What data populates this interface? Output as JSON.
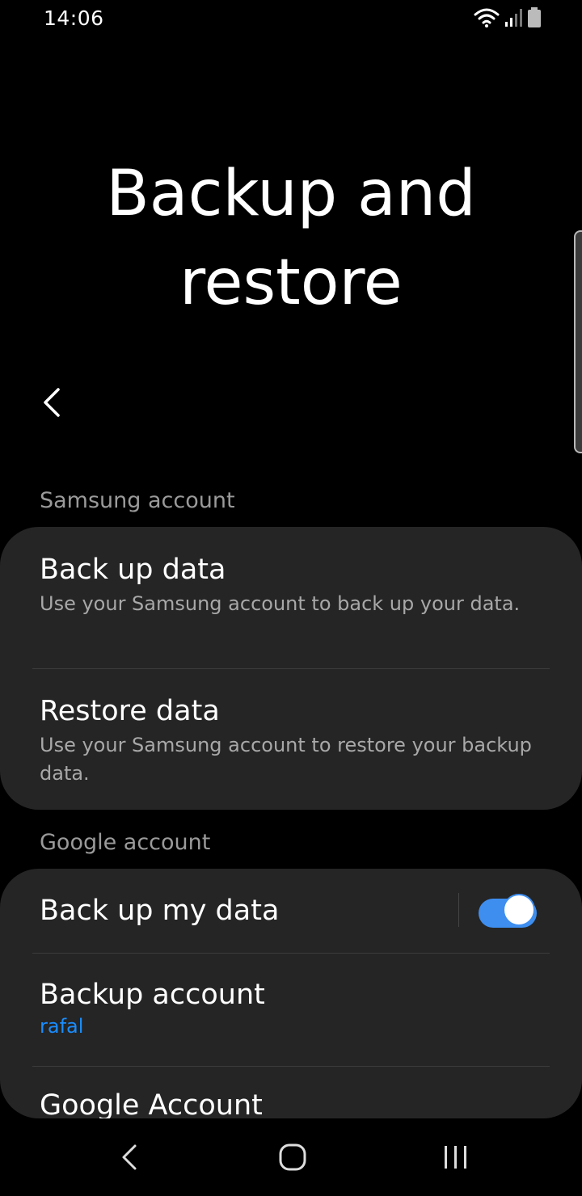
{
  "status_bar": {
    "time": "14:06",
    "icons": [
      "wifi-icon",
      "signal-icon",
      "battery-icon"
    ]
  },
  "page": {
    "title": "Backup and restore"
  },
  "sections": {
    "samsung": {
      "header": "Samsung account",
      "items": [
        {
          "title": "Back up data",
          "subtitle": "Use your Samsung account to back up your data."
        },
        {
          "title": "Restore data",
          "subtitle": "Use your Samsung account to restore your backup data."
        }
      ]
    },
    "google": {
      "header": "Google account",
      "items": [
        {
          "title": "Back up my data",
          "toggle_on": true
        },
        {
          "title": "Backup account",
          "value": "rafal"
        },
        {
          "title": "Google Account"
        }
      ]
    }
  },
  "colors": {
    "background": "#000000",
    "card": "#252525",
    "accent": "#3e8ef0",
    "link": "#1a8dff",
    "secondary_text": "#a8a8a8"
  },
  "nav_bar": {
    "icons": [
      "back-icon",
      "home-icon",
      "recents-icon"
    ]
  }
}
